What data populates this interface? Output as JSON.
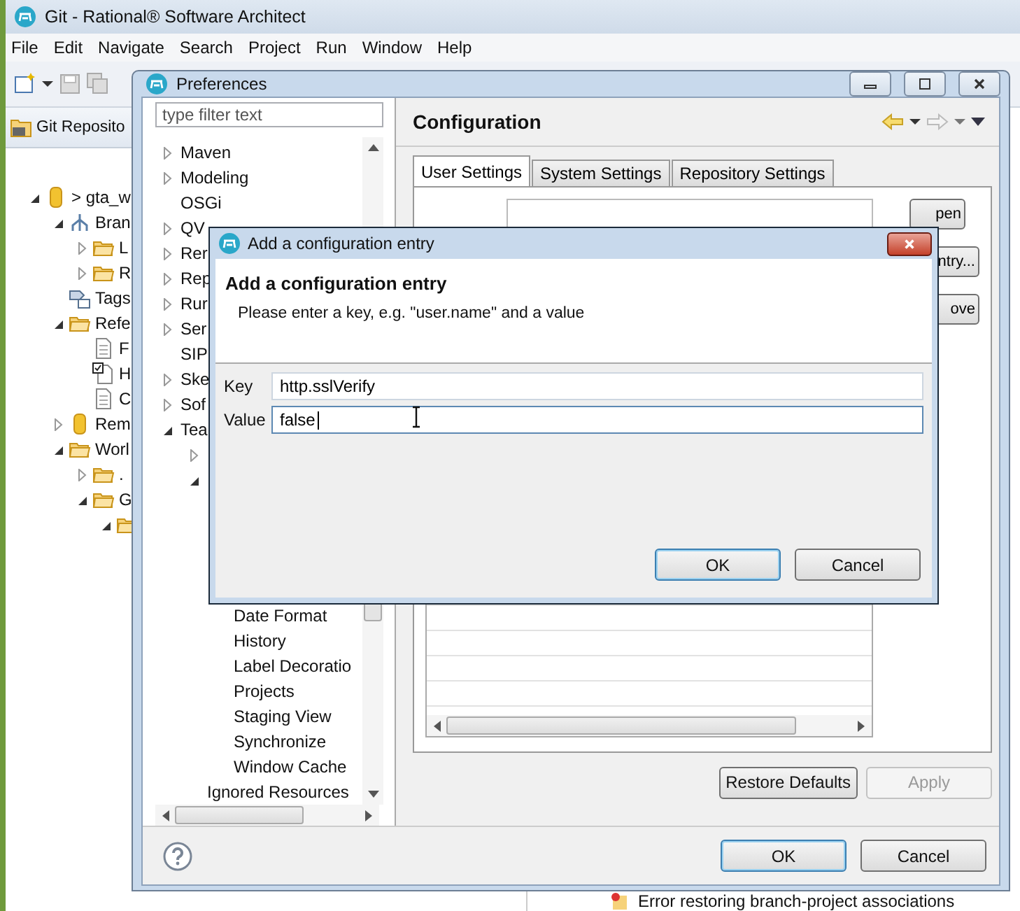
{
  "window": {
    "title": "Git - Rational® Software Architect"
  },
  "menu": [
    "File",
    "Edit",
    "Navigate",
    "Search",
    "Project",
    "Run",
    "Window",
    "Help"
  ],
  "git_view": {
    "title": "Git Reposito",
    "tree": [
      {
        "label": "> gta_w",
        "kind": "repository",
        "expanded": true,
        "children": [
          {
            "label": "Bran",
            "kind": "branches",
            "expanded": true,
            "children": [
              {
                "label": "L",
                "kind": "folder",
                "expanded": false
              },
              {
                "label": "R",
                "kind": "folder",
                "expanded": false
              }
            ]
          },
          {
            "label": "Tags",
            "kind": "tags"
          },
          {
            "label": "Refe",
            "kind": "folder",
            "expanded": true,
            "children": [
              {
                "label": "F",
                "kind": "file"
              },
              {
                "label": "H",
                "kind": "checked-file"
              },
              {
                "label": "C",
                "kind": "file"
              }
            ]
          },
          {
            "label": "Rem",
            "kind": "remote",
            "expanded": false
          },
          {
            "label": "Worl",
            "kind": "folder",
            "expanded": true,
            "children": [
              {
                "label": ".",
                "kind": "folder",
                "expanded": false
              },
              {
                "label": "G",
                "kind": "folder",
                "expanded": true,
                "children": [
                  {
                    "kind": "folder",
                    "expanded": true
                  }
                ]
              }
            ]
          }
        ]
      }
    ]
  },
  "problems": {
    "entry": "Error restoring branch-project associations"
  },
  "preferences": {
    "title": "Preferences",
    "filter_placeholder": "type filter text",
    "tree": [
      {
        "label": "Maven",
        "expanded": false
      },
      {
        "label": "Modeling",
        "expanded": false
      },
      {
        "label": "OSGi"
      },
      {
        "label": "QV",
        "expanded": false
      },
      {
        "label": "Rer",
        "expanded": false
      },
      {
        "label": "Rep",
        "expanded": false
      },
      {
        "label": "Rur",
        "expanded": false
      },
      {
        "label": "Ser",
        "expanded": false
      },
      {
        "label": "SIP"
      },
      {
        "label": "Ske",
        "expanded": false
      },
      {
        "label": "Sof",
        "expanded": false
      },
      {
        "label": "Tea",
        "expanded": true,
        "children": [
          {
            "expanded": false
          },
          {
            "expanded": true,
            "children": [
              {
                "label": "Date Format"
              },
              {
                "label": "History"
              },
              {
                "label": "Label Decoratio"
              },
              {
                "label": "Projects"
              },
              {
                "label": "Staging View"
              },
              {
                "label": "Synchronize"
              },
              {
                "label": "Window Cache"
              }
            ]
          },
          {
            "label": "Ignored Resources"
          }
        ]
      }
    ],
    "page_title": "Configuration",
    "tabs": [
      {
        "label": "User Settings",
        "selected": true
      },
      {
        "label": "System Settings",
        "selected": false
      },
      {
        "label": "Repository Settings",
        "selected": false
      }
    ],
    "side_buttons": [
      "pen",
      "ntry...",
      "ove"
    ],
    "restore": "Restore Defaults",
    "apply": {
      "label": "Apply",
      "disabled": true
    },
    "buttons": [
      {
        "label": "OK",
        "default": true
      },
      {
        "label": "Cancel",
        "default": false
      }
    ]
  },
  "dialog": {
    "title": "Add a configuration entry",
    "heading": "Add a configuration entry",
    "description": "Please enter a key, e.g. \"user.name\" and a value",
    "fields": [
      {
        "label": "Key",
        "value": "http.sslVerify",
        "focused": false
      },
      {
        "label": "Value",
        "value": "false",
        "focused": true
      }
    ],
    "buttons": [
      {
        "label": "OK",
        "default": true
      },
      {
        "label": "Cancel",
        "default": false
      }
    ]
  }
}
